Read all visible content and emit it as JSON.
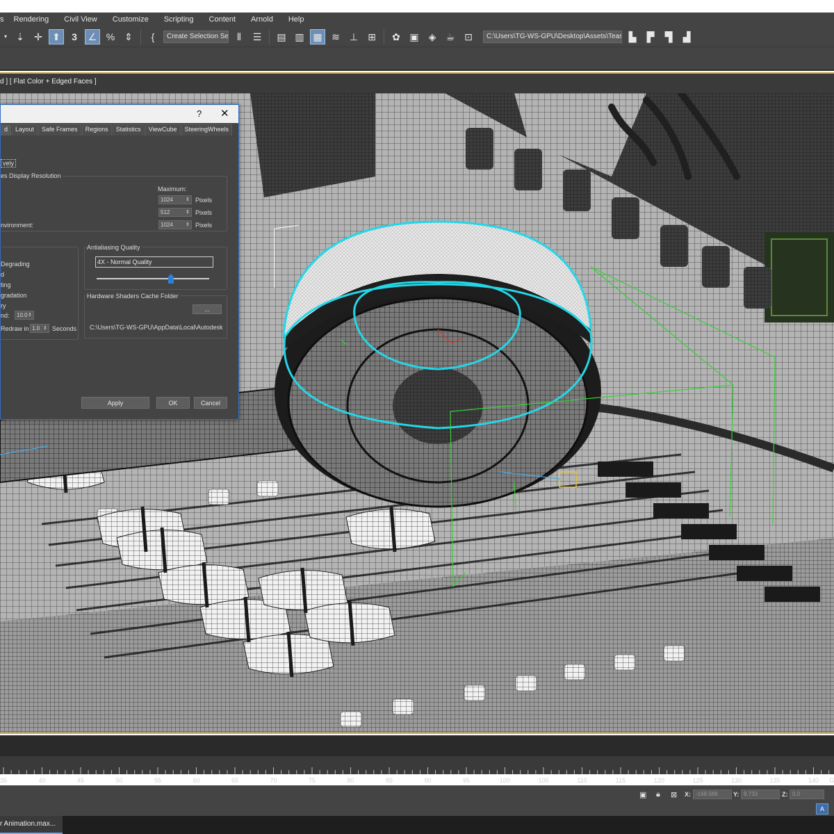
{
  "menubar": {
    "items": [
      "s",
      "Rendering",
      "Civil View",
      "Customize",
      "Scripting",
      "Content",
      "Arnold",
      "Help"
    ]
  },
  "toolbar": {
    "selection_set_label": "Create Selection Se",
    "project_path": "C:\\Users\\TG-WS-GPU\\Desktop\\Assets\\Teaset"
  },
  "viewport": {
    "label": "d ] [ Flat Color + Edged Faces ]"
  },
  "dialog": {
    "help_glyph": "?",
    "close_glyph": "✕",
    "tabs": [
      "d",
      "Layout",
      "Safe Frames",
      "Regions",
      "Statistics",
      "ViewCube",
      "SteeringWheels"
    ],
    "clipped_option": "vely",
    "resolution_group_title": "es Display Resolution",
    "maximum_label": "Maximum:",
    "resolution_rows": [
      {
        "label": "",
        "value": "1024",
        "unit": "Pixels"
      },
      {
        "label": "",
        "value": "512",
        "unit": "Pixels"
      },
      {
        "label": "nvironment:",
        "value": "1024",
        "unit": "Pixels"
      }
    ],
    "degradation_items": [
      "Degrading",
      "d",
      "ting",
      "gradation",
      "ry"
    ],
    "degrade_row_label": "nd:",
    "degrade_value": "10.0",
    "redraw_label": "Redraw in",
    "redraw_value": "1.0",
    "redraw_unit": "Seconds",
    "aa_group_title": "Antialiasing Quality",
    "aa_value": "4X - Normal Quality",
    "aa_level_percent": 66,
    "cache_group_title": "Hardware Shaders Cache Folder",
    "browse_label": "...",
    "cache_path": "C:\\Users\\TG-WS-GPU\\AppData\\Local\\Autodesk",
    "apply_label": "Apply",
    "ok_label": "OK",
    "cancel_label": "Cancel"
  },
  "timeline": {
    "frame_numbers": [
      "35",
      "40",
      "45",
      "50",
      "55",
      "60",
      "65",
      "70",
      "75",
      "80",
      "85",
      "90",
      "95",
      "100",
      "105",
      "110",
      "115",
      "120",
      "125",
      "130",
      "135",
      "140"
    ],
    "end_label": "G"
  },
  "status": {
    "x_label": "X:",
    "x_value": "-168.589",
    "y_label": "Y:",
    "y_value": "9.733",
    "z_label": "Z:",
    "z_value": "0.0",
    "tray_label": "A"
  },
  "taskbar": {
    "active_window": "r Animation.max..."
  },
  "colors": {
    "ui_bg": "#444444",
    "viewport_border": "#c8a94a",
    "selection_cyan": "#25d6e6",
    "bbox_green": "#36d136",
    "dialog_border": "#2e6ec4"
  }
}
